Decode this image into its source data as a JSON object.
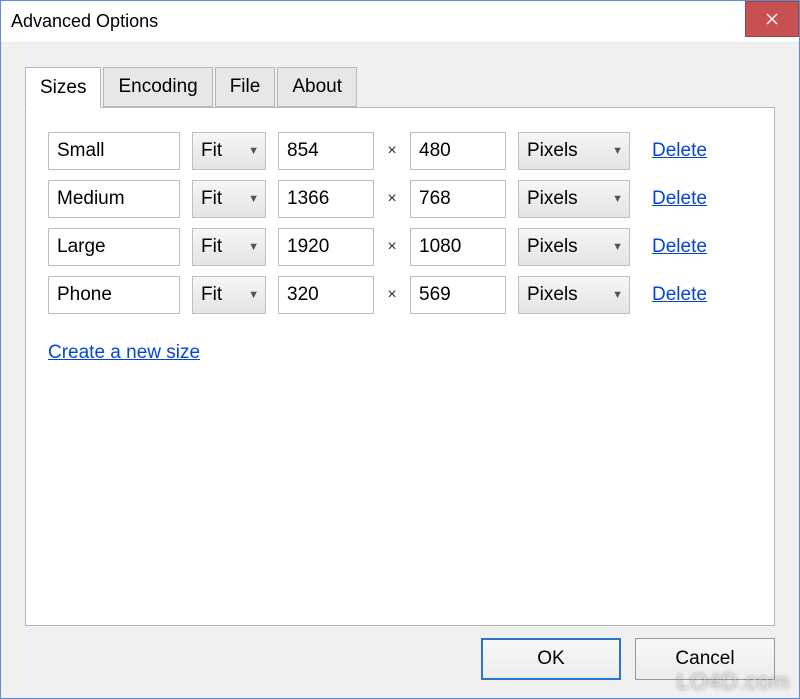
{
  "window": {
    "title": "Advanced Options"
  },
  "tabs": [
    {
      "label": "Sizes",
      "active": true
    },
    {
      "label": "Encoding",
      "active": false
    },
    {
      "label": "File",
      "active": false
    },
    {
      "label": "About",
      "active": false
    }
  ],
  "sizes": [
    {
      "name": "Small",
      "fit": "Fit",
      "width": "854",
      "height": "480",
      "unit": "Pixels",
      "delete_label": "Delete"
    },
    {
      "name": "Medium",
      "fit": "Fit",
      "width": "1366",
      "height": "768",
      "unit": "Pixels",
      "delete_label": "Delete"
    },
    {
      "name": "Large",
      "fit": "Fit",
      "width": "1920",
      "height": "1080",
      "unit": "Pixels",
      "delete_label": "Delete"
    },
    {
      "name": "Phone",
      "fit": "Fit",
      "width": "320",
      "height": "569",
      "unit": "Pixels",
      "delete_label": "Delete"
    }
  ],
  "times_symbol": "×",
  "create_link_label": "Create a new size",
  "buttons": {
    "ok": "OK",
    "cancel": "Cancel"
  },
  "watermark": "LO4D.com"
}
